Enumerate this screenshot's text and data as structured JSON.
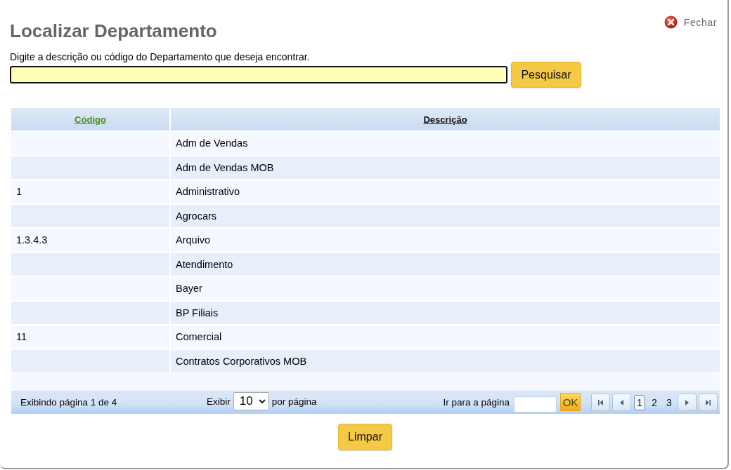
{
  "dialog": {
    "title": "Localizar Departamento",
    "close_label": "Fechar"
  },
  "search": {
    "instruction": "Digite a descrição ou código do Departamento que deseja encontrar.",
    "button": "Pesquisar"
  },
  "table": {
    "columns": [
      {
        "label": "Código",
        "selected": true
      },
      {
        "label": "Descrição",
        "selected": false
      }
    ],
    "rows": [
      {
        "description": "Adm de Vendas"
      },
      {
        "description": "Adm de Vendas MOB"
      },
      {
        "code": "1",
        "description": "Administrativo"
      },
      {
        "description": "Agrocars"
      },
      {
        "code": "1.3.4.3",
        "description": "Arquivo"
      },
      {
        "description": "Atendimento"
      },
      {
        "description": "Bayer"
      },
      {
        "description": "BP Filiais"
      },
      {
        "code": "11",
        "description": "Comercial"
      },
      {
        "description": "Contratos Corporativos MOB"
      }
    ]
  },
  "pager": {
    "status": "Exibindo página 1 de 4",
    "show_label": "Exibir",
    "page_size": "10",
    "per_page_label": "por página",
    "goto_label": "Ir para a página",
    "goto_button": "OK",
    "pages": [
      {
        "label": "1",
        "selected": true
      },
      {
        "label": "2",
        "selected": false
      },
      {
        "label": "3",
        "selected": false
      }
    ]
  },
  "footer": {
    "button": "Limpar"
  }
}
